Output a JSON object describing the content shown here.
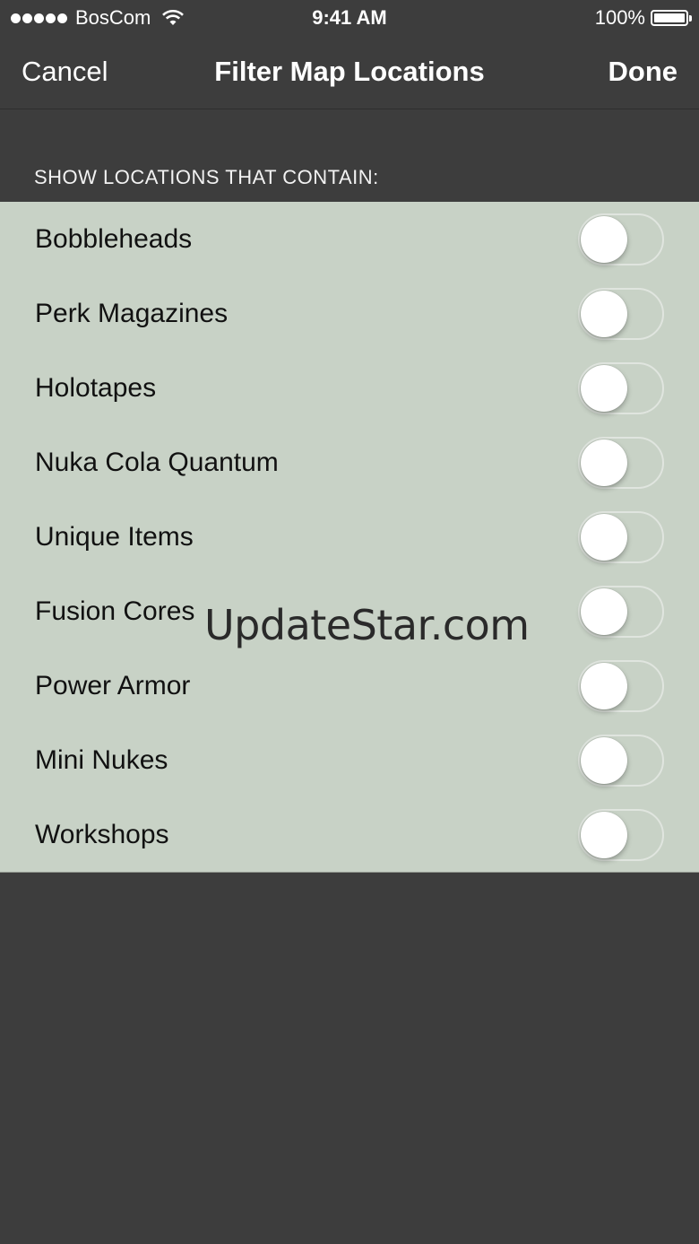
{
  "status_bar": {
    "carrier": "BosCom",
    "time": "9:41 AM",
    "battery": "100%"
  },
  "nav": {
    "cancel": "Cancel",
    "title": "Filter Map Locations",
    "done": "Done"
  },
  "section": {
    "header": "SHOW LOCATIONS THAT CONTAIN:"
  },
  "filters": [
    {
      "label": "Bobbleheads",
      "on": false
    },
    {
      "label": "Perk Magazines",
      "on": false
    },
    {
      "label": "Holotapes",
      "on": false
    },
    {
      "label": "Nuka Cola Quantum",
      "on": false
    },
    {
      "label": "Unique Items",
      "on": false
    },
    {
      "label": "Fusion Cores",
      "on": false
    },
    {
      "label": "Power Armor",
      "on": false
    },
    {
      "label": "Mini Nukes",
      "on": false
    },
    {
      "label": "Workshops",
      "on": false
    }
  ],
  "watermark": "UpdateStar.com",
  "colors": {
    "background": "#3d3d3d",
    "list_background": "#c8d2c6",
    "text_light": "#ffffff",
    "text_dark": "#111111"
  }
}
